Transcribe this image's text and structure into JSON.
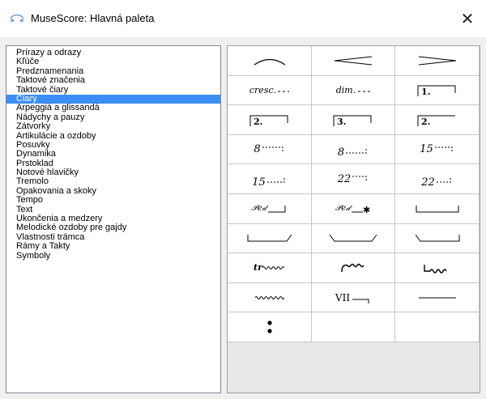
{
  "window": {
    "title": "MuseScore: Hlavná paleta",
    "close_glyph": "✕"
  },
  "categories": [
    "Prírazy a odrazy",
    "Kľúče",
    "Predznamenania",
    "Taktové značenia",
    "Taktové čiary",
    "Čiary",
    "Arpeggiá a glissandá",
    "Nádychy a pauzy",
    "Zátvorky",
    "Artikulácie a ozdoby",
    "Posuvky",
    "Dynamika",
    "Prstoklad",
    "Notové hlavičky",
    "Tremolo",
    "Opakovania a skoky",
    "Tempo",
    "Text",
    "Ukončenia a medzery",
    "Melodické ozdoby pre gajdy",
    "Vlastnosti trámca",
    "Rámy a Takty",
    "Symboly"
  ],
  "selected_category": "Čiary",
  "palette_text": {
    "cresc": "cresc.",
    "dim": "dim.",
    "volta1": "1.",
    "volta2": "2.",
    "volta3": "3.",
    "ottava8": "8",
    "ottava15": "15",
    "ottava22": "22",
    "ped": "𝒫𝑒𝒹",
    "tr": "tr",
    "vii": "VII"
  },
  "colors": {
    "selection": "#3b8ef3",
    "grid_line": "#c8c8c8"
  }
}
